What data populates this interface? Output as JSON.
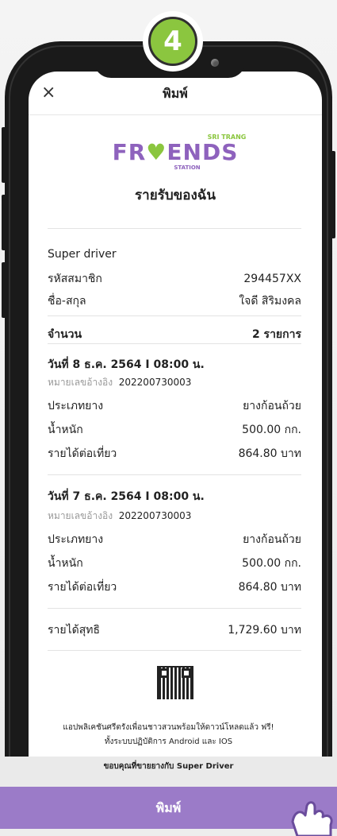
{
  "step_number": "4",
  "header": {
    "close_glyph": "×",
    "title": "พิมพ์"
  },
  "logo": {
    "top_text": "SRI TRANG",
    "main_text_left": "FR",
    "main_text_right": "ENDS",
    "sub_text": "STATION"
  },
  "page_title": "รายรับของฉัน",
  "driver_type": "Super driver",
  "member": {
    "label_id": "รหัสสมาชิก",
    "value_id": "294457XX",
    "label_name": "ชื่อ-สกุล",
    "value_name": "ใจดี สิริมงคล"
  },
  "count": {
    "label": "จำนวน",
    "value": "2 รายการ"
  },
  "entries": [
    {
      "date": "วันที่  8 ธ.ค. 2564 I 08:00 น.",
      "ref_label": "หมายเลขอ้างอิง",
      "ref_value": "202200730003",
      "type_label": "ประเภทยาง",
      "type_value": "ยางก้อนถ้วย",
      "weight_label": "น้ำหนัก",
      "weight_value": "500.00  กก.",
      "income_label": "รายได้ต่อเที่ยว",
      "income_value": "864.80 บาท"
    },
    {
      "date": "วันที่  7 ธ.ค. 2564 I 08:00 น.",
      "ref_label": "หมายเลขอ้างอิง",
      "ref_value": "202200730003",
      "type_label": "ประเภทยาง",
      "type_value": "ยางก้อนถ้วย",
      "weight_label": "น้ำหนัก",
      "weight_value": "500.00  กก.",
      "income_label": "รายได้ต่อเที่ยว",
      "income_value": "864.80 บาท"
    }
  ],
  "net": {
    "label": "รายได้สุทธิ",
    "value": "1,729.60 บาท"
  },
  "footer": {
    "line1": "แอปพลิเคชันศรีตรังเพื่อนชาวสวนพร้อมให้ดาวน์โหลดแล้ว ฟรี!",
    "line2": "ทั้งระบบปฏิบัติการ Android และ IOS",
    "line3": "ขอบคุณที่ขายยางกับ  Super Driver"
  },
  "print_button": "พิมพ์",
  "colors": {
    "brand_purple": "#8e62bd",
    "brand_green": "#8bc63f",
    "print_bar": "#9b7bc8"
  }
}
